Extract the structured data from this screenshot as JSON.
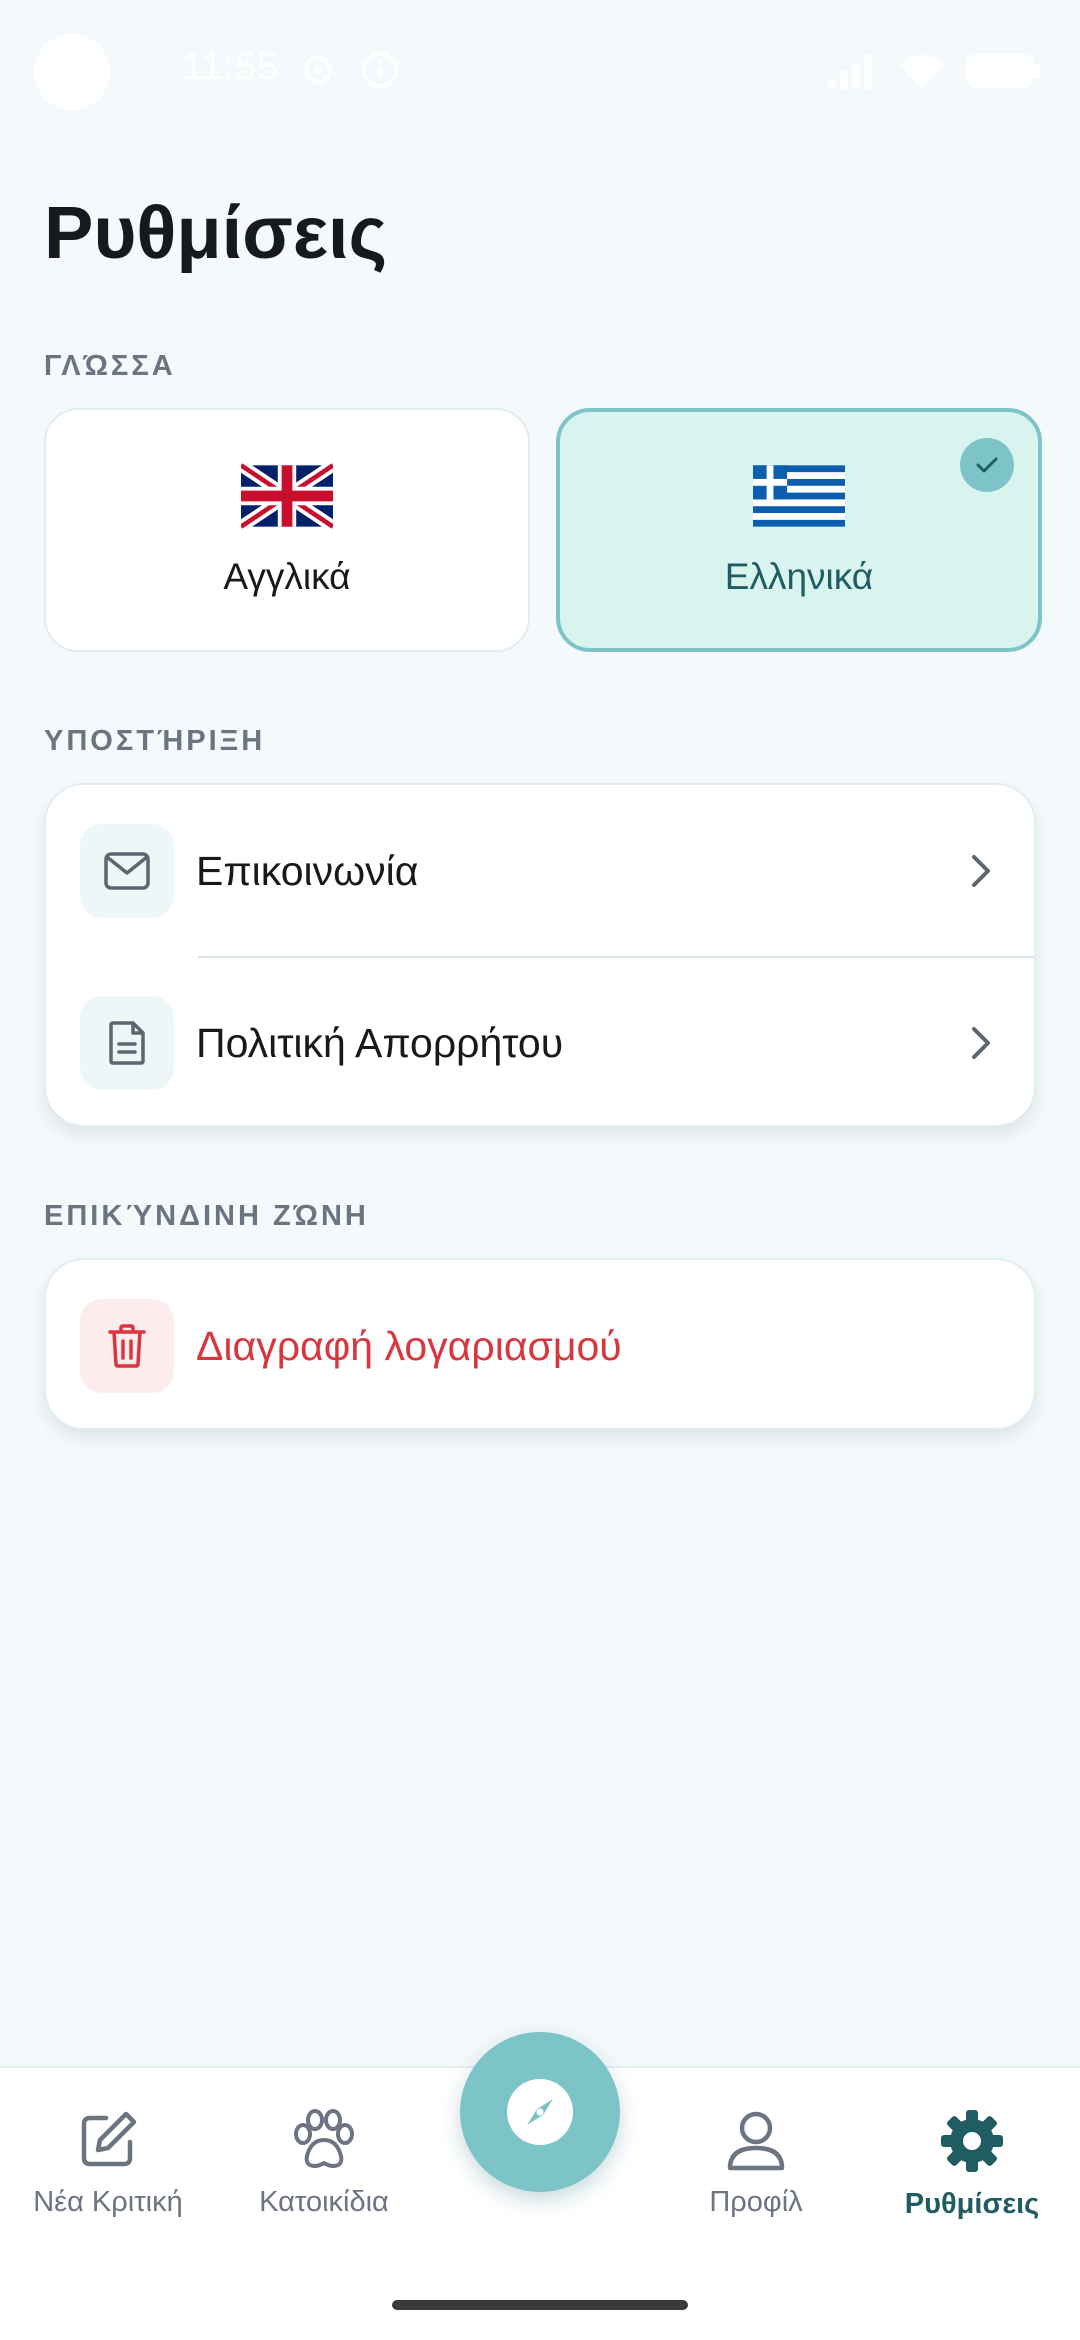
{
  "status_bar": {
    "time": "11:55"
  },
  "page": {
    "title": "Ρυθμίσεις"
  },
  "language": {
    "section_label": "ΓΛΏΣΣΑ",
    "options": [
      {
        "label": "Αγγλικά",
        "flag": "uk-flag",
        "selected": false
      },
      {
        "label": "Ελληνικά",
        "flag": "greece-flag",
        "selected": true
      }
    ]
  },
  "support": {
    "section_label": "ΥΠΟΣΤΉΡΙΞΗ",
    "items": [
      {
        "label": "Επικοινωνία",
        "icon": "mail-icon"
      },
      {
        "label": "Πολιτική Απορρήτου",
        "icon": "document-icon"
      }
    ]
  },
  "danger_zone": {
    "section_label": "ΕΠΙΚΎΝΔΙΝΗ ΖΏΝΗ",
    "items": [
      {
        "label": "Διαγραφή λογαριασμού",
        "icon": "trash-icon"
      }
    ]
  },
  "bottom_nav": {
    "items": [
      {
        "label": "Νέα Κριτική",
        "icon": "edit-icon"
      },
      {
        "label": "Κατοικίδια",
        "icon": "paw-icon"
      },
      {
        "label": "Προφίλ",
        "icon": "user-icon"
      },
      {
        "label": "Ρυθμίσεις",
        "icon": "gear-icon",
        "active": true
      }
    ],
    "fab_icon": "compass-icon"
  },
  "colors": {
    "background": "#f4f9fb",
    "accent": "#7cc4c8",
    "accent_dark": "#1f5d63",
    "selected_card": "#d9f3ee",
    "danger": "#d9363e",
    "muted": "#6b7480"
  }
}
